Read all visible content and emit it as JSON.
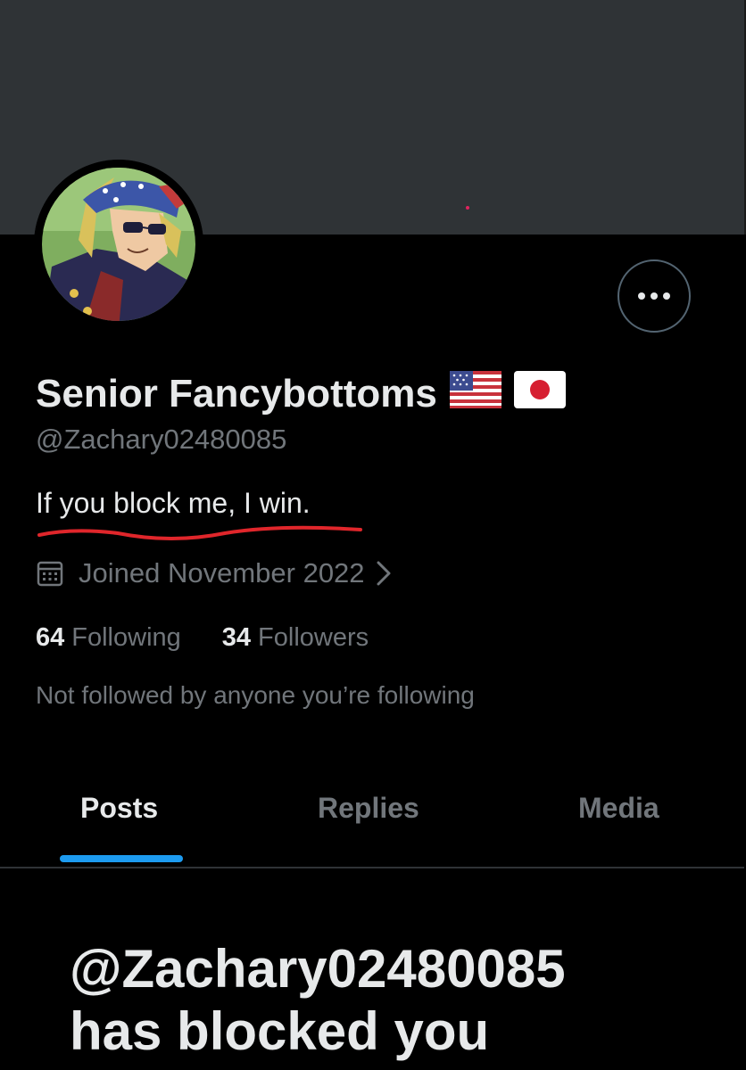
{
  "profile": {
    "display_name": "Senior Fancybottoms",
    "flags": [
      "us-flag-icon",
      "japan-flag-icon"
    ],
    "handle": "@Zachary02480085",
    "bio": "If you block me, I win.",
    "joined": "Joined November 2022",
    "following_count": "64",
    "following_label": "Following",
    "followers_count": "34",
    "followers_label": "Followers",
    "not_followed_text": "Not followed by anyone you’re following"
  },
  "tabs": [
    {
      "label": "Posts",
      "selected": true
    },
    {
      "label": "Replies",
      "selected": false
    },
    {
      "label": "Media",
      "selected": false
    }
  ],
  "blocked_notice": {
    "line1": "@Zachary02480085",
    "line2": "has blocked you"
  },
  "colors": {
    "background": "#000000",
    "banner": "#2f3336",
    "text_primary": "#e7e9ea",
    "text_secondary": "#71767b",
    "accent": "#1d9bf0",
    "annotation_underline": "#e0262b"
  },
  "icons": [
    "more-options-icon",
    "calendar-icon",
    "chevron-right-icon"
  ]
}
